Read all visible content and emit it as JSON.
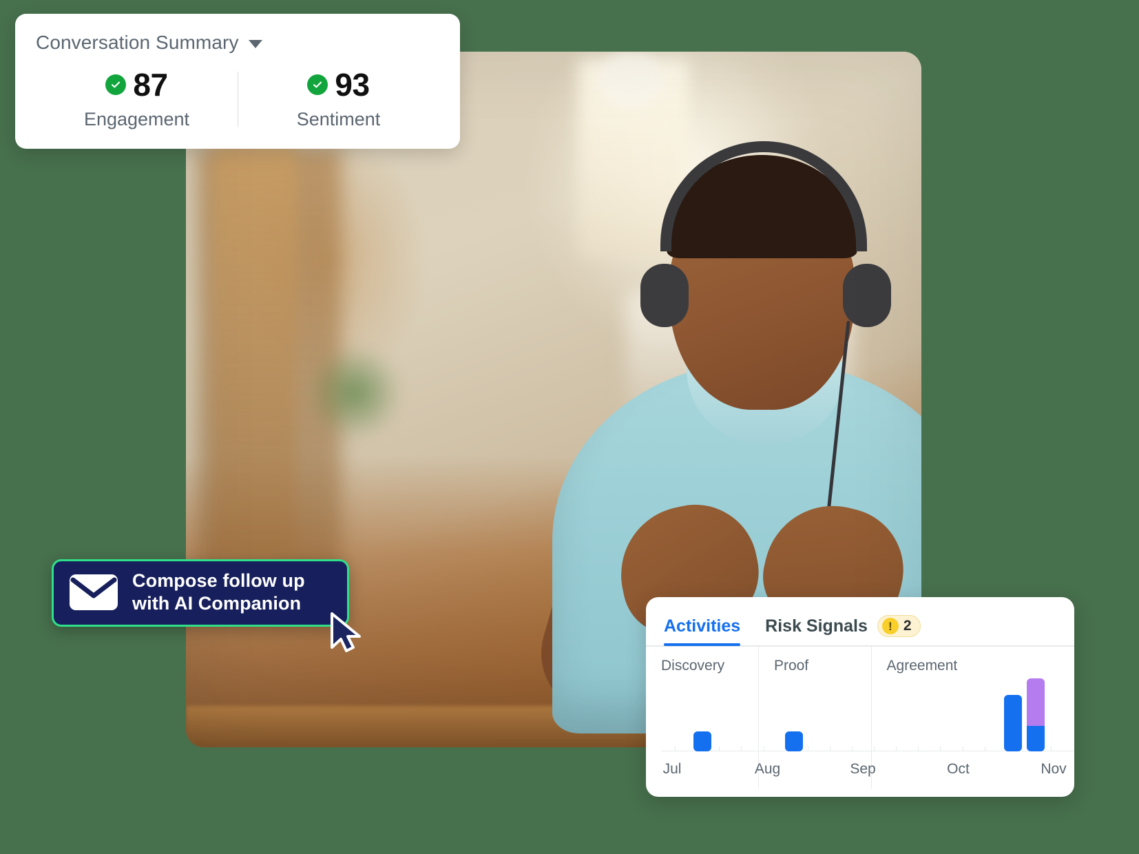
{
  "background_color": "#47704d",
  "summary_card": {
    "title": "Conversation Summary",
    "caret_icon": "chevron-down-icon",
    "metrics": [
      {
        "value": "87",
        "label": "Engagement",
        "status_icon": "check-circle-icon",
        "status_color": "#12a53d"
      },
      {
        "value": "93",
        "label": "Sentiment",
        "status_icon": "check-circle-icon",
        "status_color": "#12a53d"
      }
    ]
  },
  "compose_pill": {
    "icon": "envelope-icon",
    "line1": "Compose follow up",
    "line2": "with AI Companion",
    "background_color": "#17205c",
    "border_color": "#2fe08a"
  },
  "cursor": {
    "icon": "mouse-pointer-icon"
  },
  "activities_panel": {
    "tabs": [
      {
        "label": "Activities",
        "active": true
      },
      {
        "label": "Risk Signals",
        "active": false
      }
    ],
    "risk_badge": {
      "warn_glyph": "!",
      "count": "2",
      "background_color": "#fdf3d2",
      "dot_color": "#f8cf2b"
    },
    "accent_color": "#1570ef",
    "chart_data": {
      "type": "bar",
      "title": "",
      "xlabel": "",
      "ylabel": "",
      "categories": [
        "Jul",
        "Aug",
        "Sep",
        "Oct",
        "Nov"
      ],
      "stage_columns": [
        {
          "label": "Discovery",
          "start_frac": 0.0,
          "end_frac": 0.262
        },
        {
          "label": "Proof",
          "start_frac": 0.262,
          "end_frac": 0.525
        },
        {
          "label": "Agreement",
          "start_frac": 0.525,
          "end_frac": 1.0
        }
      ],
      "series": [
        {
          "name": "Activities",
          "color": "#1570ef"
        },
        {
          "name": "Risk",
          "color": "#b57cf0"
        }
      ],
      "bars": [
        {
          "x_frac": 0.075,
          "activities": 22,
          "risk": 0
        },
        {
          "x_frac": 0.305,
          "activities": 22,
          "risk": 0
        },
        {
          "x_frac": 0.855,
          "activities": 62,
          "risk": 0
        },
        {
          "x_frac": 0.912,
          "activities": 28,
          "risk": 52
        }
      ],
      "ylim": [
        0,
        100
      ],
      "grid": false,
      "legend": "none",
      "tick_count": 18
    }
  }
}
